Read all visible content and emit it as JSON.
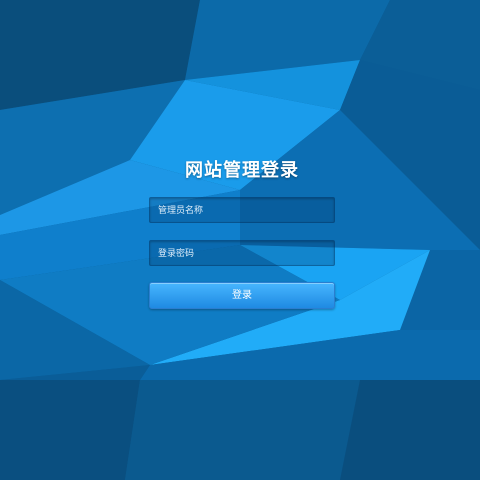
{
  "login": {
    "title": "网站管理登录",
    "username_placeholder": "管理员名称",
    "password_placeholder": "登录密码",
    "submit_label": "登录"
  },
  "colors": {
    "background_dark": "#0a4f7e",
    "background_mid": "#0b6db2",
    "background_bright": "#1fa5f5",
    "button_top": "#47b6ff",
    "button_bottom": "#1f8ae2",
    "text": "#ffffff"
  }
}
